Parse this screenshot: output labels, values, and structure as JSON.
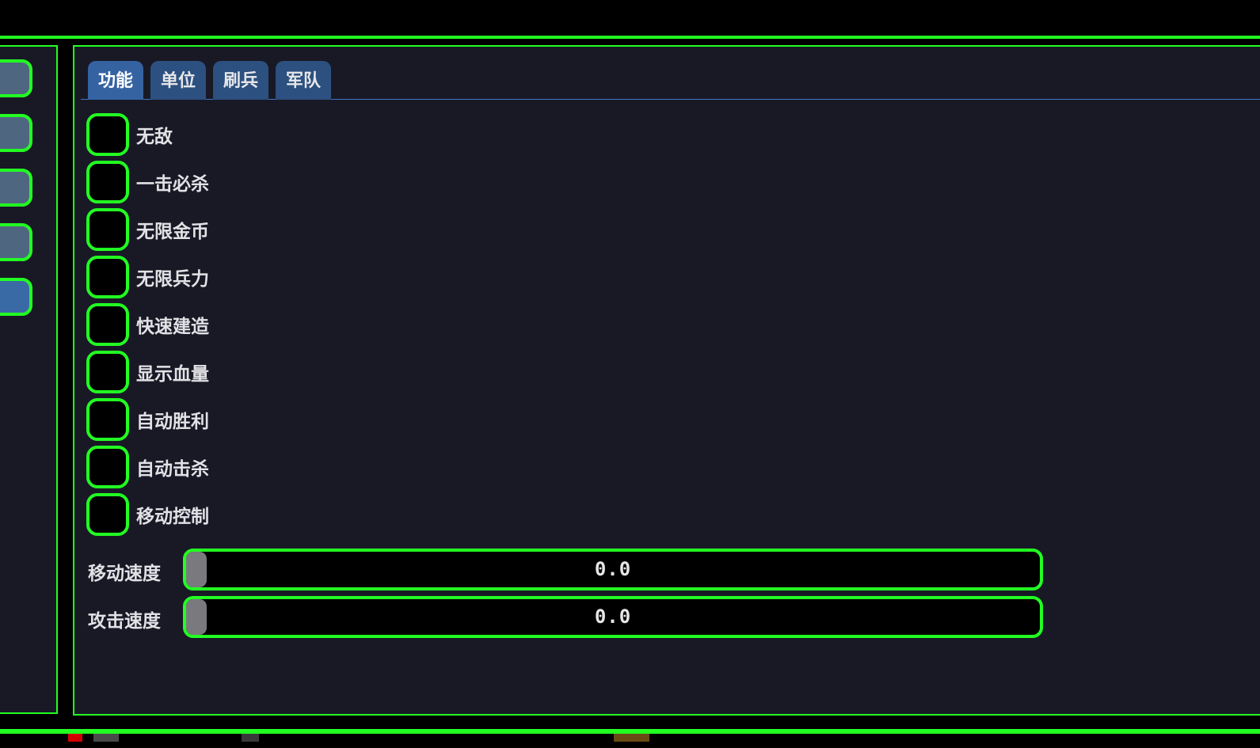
{
  "colors": {
    "accent_green": "#22ff22",
    "panel_bg": "#191926",
    "tab_active": "#3563a2",
    "tab_inactive": "#2c507f",
    "side_button": "#4f6680",
    "side_button_active": "#3a6aa5",
    "slider_grab": "#7a7a7e"
  },
  "sidebar": {
    "buttons": [
      {
        "active": false
      },
      {
        "active": false
      },
      {
        "active": false
      },
      {
        "active": false
      },
      {
        "active": true
      }
    ]
  },
  "tabs": [
    {
      "label": "功能",
      "active": true
    },
    {
      "label": "单位",
      "active": false
    },
    {
      "label": "刷兵",
      "active": false
    },
    {
      "label": "军队",
      "active": false
    }
  ],
  "features": [
    {
      "label": "无敌",
      "checked": false
    },
    {
      "label": "一击必杀",
      "checked": false
    },
    {
      "label": "无限金币",
      "checked": false
    },
    {
      "label": "无限兵力",
      "checked": false
    },
    {
      "label": "快速建造",
      "checked": false
    },
    {
      "label": "显示血量",
      "checked": false
    },
    {
      "label": "自动胜利",
      "checked": false
    },
    {
      "label": "自动击杀",
      "checked": false
    },
    {
      "label": "移动控制",
      "checked": false
    }
  ],
  "sliders": [
    {
      "label": "移动速度",
      "value": 0.0,
      "value_text": "0.0"
    },
    {
      "label": "攻击速度",
      "value": 0.0,
      "value_text": "0.0"
    }
  ]
}
